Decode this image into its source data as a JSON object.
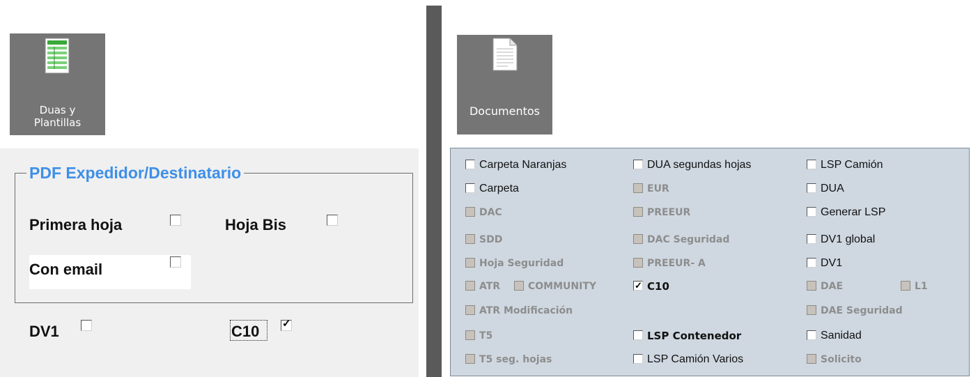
{
  "left": {
    "tile": {
      "line1": "Duas y",
      "line2": "Plantillas",
      "icon": "spreadsheet-icon"
    },
    "group_title": "PDF Expedidor/Destinatario",
    "primera_hoja": {
      "label": "Primera hoja",
      "checked": false
    },
    "hoja_bis": {
      "label": "Hoja Bis",
      "checked": false
    },
    "con_email": {
      "label": "Con email",
      "checked": false
    },
    "dv1": {
      "label": "DV1",
      "checked": false
    },
    "c10": {
      "label": "C10",
      "checked": true
    }
  },
  "right": {
    "tile": {
      "label": "Documentos",
      "icon": "document-icon"
    },
    "col1": [
      {
        "label": "Carpeta Naranjas",
        "state": "enabled",
        "checked": false
      },
      {
        "label": "Carpeta",
        "state": "enabled",
        "checked": false
      },
      {
        "label": "DAC",
        "state": "disabled",
        "checked": false
      },
      {
        "label": "SDD",
        "state": "disabled",
        "checked": false
      },
      {
        "label": "Hoja Seguridad",
        "state": "disabled",
        "checked": false
      },
      {
        "label": "ATR",
        "state": "disabled",
        "checked": false
      },
      {
        "label": "ATR Modificación",
        "state": "disabled",
        "checked": false
      },
      {
        "label": "T5",
        "state": "disabled",
        "checked": false
      },
      {
        "label": "T5 seg. hojas",
        "state": "disabled",
        "checked": false
      }
    ],
    "community": {
      "label": "COMMUNITY",
      "state": "disabled",
      "checked": false
    },
    "col2": [
      {
        "label": "DUA segundas hojas",
        "state": "enabled",
        "checked": false
      },
      {
        "label": "EUR",
        "state": "disabled",
        "checked": false
      },
      {
        "label": "PREEUR",
        "state": "disabled",
        "checked": false
      },
      {
        "label": "DAC Seguridad",
        "state": "disabled",
        "checked": false
      },
      {
        "label": "PREEUR- A",
        "state": "disabled",
        "checked": false
      },
      {
        "label": "C10",
        "state": "bold",
        "checked": true
      },
      {
        "label": "LSP Contenedor",
        "state": "bold",
        "checked": false
      },
      {
        "label": "LSP Camión Varios",
        "state": "enabled",
        "checked": false
      }
    ],
    "col3": [
      {
        "label": "LSP Camión",
        "state": "enabled",
        "checked": false
      },
      {
        "label": "DUA",
        "state": "enabled",
        "checked": false
      },
      {
        "label": "Generar LSP",
        "state": "enabled",
        "checked": false
      },
      {
        "label": "DV1 global",
        "state": "enabled",
        "checked": false
      },
      {
        "label": "DV1",
        "state": "enabled",
        "checked": false
      },
      {
        "label": "DAE",
        "state": "disabled",
        "checked": false
      },
      {
        "label": "DAE Seguridad",
        "state": "disabled",
        "checked": false
      },
      {
        "label": "Sanidad",
        "state": "enabled",
        "checked": false
      },
      {
        "label": "Solicito",
        "state": "disabled",
        "checked": false
      }
    ],
    "l1": {
      "label": "L1",
      "state": "disabled",
      "checked": false
    }
  }
}
